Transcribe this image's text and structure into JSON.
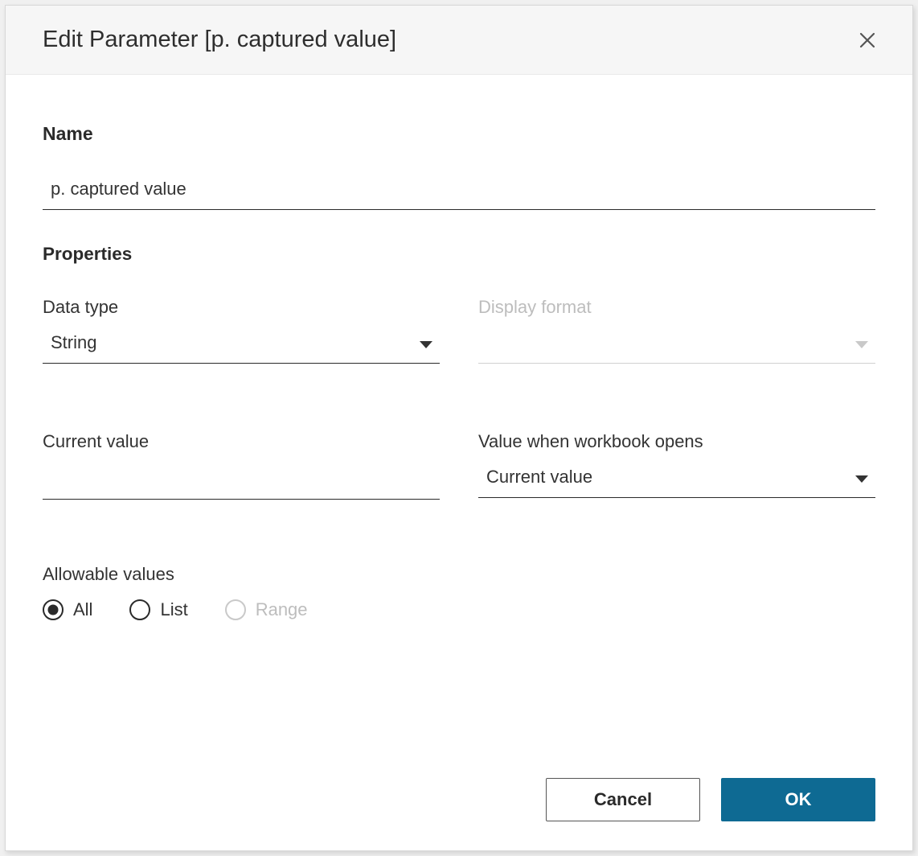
{
  "header": {
    "title": "Edit Parameter [p. captured value]"
  },
  "form": {
    "name_label": "Name",
    "name_value": "p. captured value",
    "properties_heading": "Properties",
    "data_type": {
      "label": "Data type",
      "value": "String"
    },
    "display_format": {
      "label": "Display format",
      "value": ""
    },
    "current_value": {
      "label": "Current value",
      "value": ""
    },
    "value_on_open": {
      "label": "Value when workbook opens",
      "value": "Current value"
    },
    "allowable": {
      "label": "Allowable values",
      "options": {
        "all": "All",
        "list": "List",
        "range": "Range"
      }
    }
  },
  "footer": {
    "cancel": "Cancel",
    "ok": "OK"
  }
}
